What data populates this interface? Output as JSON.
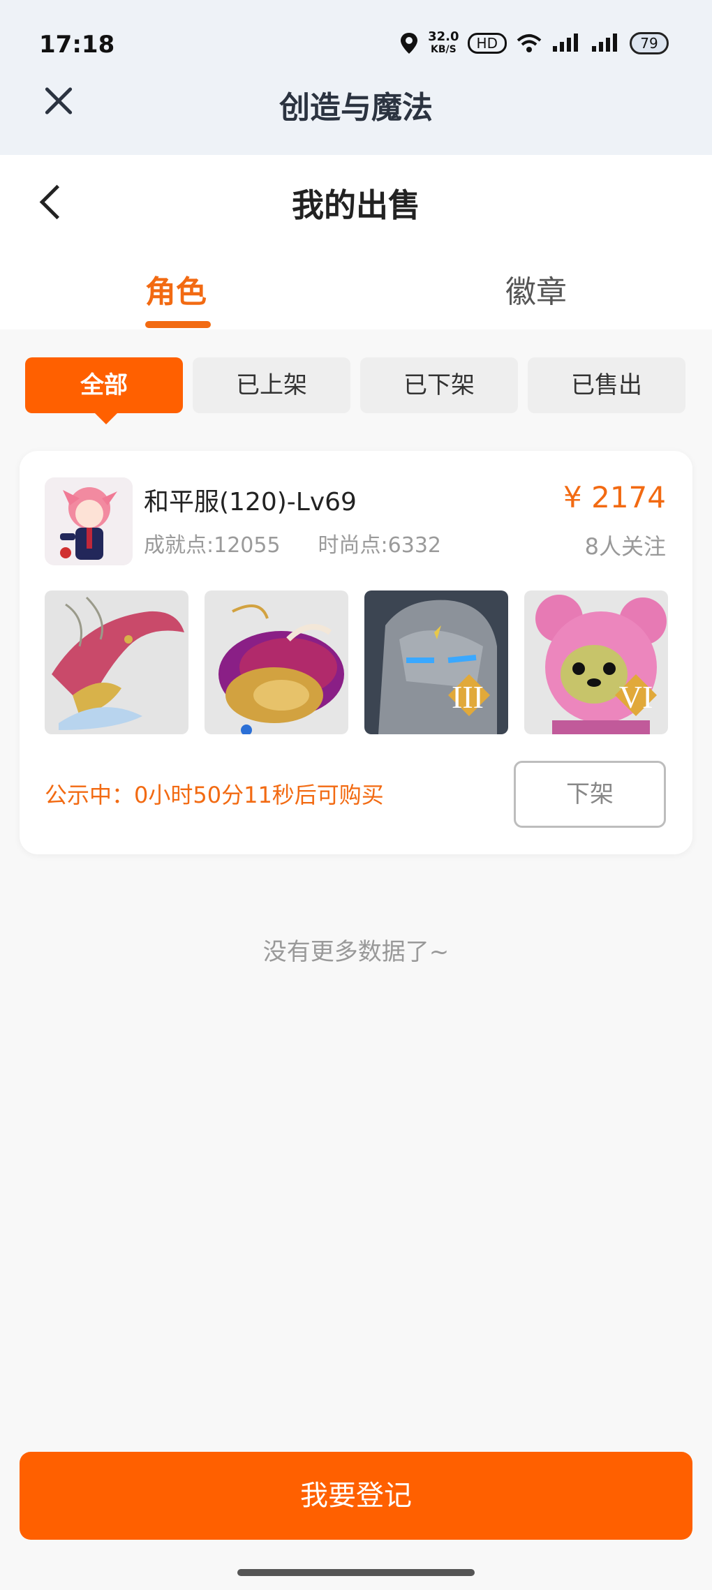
{
  "status_bar": {
    "time": "17:18",
    "speed_value": "32.0",
    "speed_unit": "KB/S",
    "hd_label": "HD",
    "battery": "79"
  },
  "app_bar": {
    "title": "创造与魔法"
  },
  "page": {
    "title": "我的出售",
    "tabs": [
      {
        "label": "角色",
        "active": true
      },
      {
        "label": "徽章",
        "active": false
      }
    ]
  },
  "filters": [
    {
      "label": "全部",
      "active": true
    },
    {
      "label": "已上架",
      "active": false
    },
    {
      "label": "已下架",
      "active": false
    },
    {
      "label": "已售出",
      "active": false
    }
  ],
  "listing": {
    "name": "和平服(120)-Lv69",
    "achievement_points": "成就点:12055",
    "fashion_points": "时尚点:6332",
    "price": "¥ 2174",
    "followers": "8人关注",
    "items": [
      {
        "icon": "dragon-mount-icon",
        "badge": ""
      },
      {
        "icon": "whale-mount-icon",
        "badge": ""
      },
      {
        "icon": "stone-golem-icon",
        "badge": "III"
      },
      {
        "icon": "pink-bear-icon",
        "badge": "VI"
      }
    ],
    "notice": "公示中：0小时50分11秒后可购买",
    "delist_label": "下架"
  },
  "no_more_text": "没有更多数据了~",
  "register_label": "我要登记",
  "colors": {
    "accent": "#ff6000",
    "accent_text": "#f26a12"
  }
}
